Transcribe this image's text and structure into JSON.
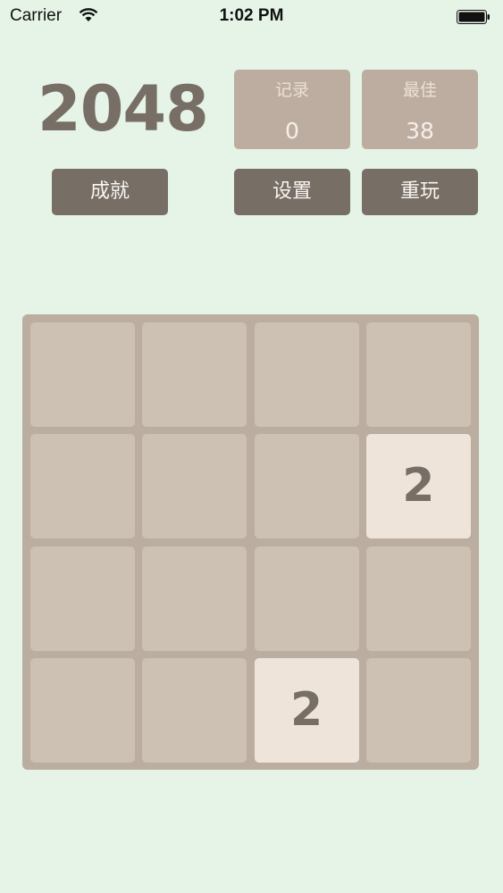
{
  "status_bar": {
    "carrier": "Carrier",
    "time": "1:02 PM"
  },
  "header": {
    "logo": "2048",
    "record": {
      "label": "记录",
      "value": "0"
    },
    "best": {
      "label": "最佳",
      "value": "38"
    }
  },
  "buttons": {
    "achievements": "成就",
    "settings": "设置",
    "restart": "重玩"
  },
  "board": {
    "size": 4,
    "tiles": [
      {
        "row": 1,
        "col": 3,
        "value": "2"
      },
      {
        "row": 3,
        "col": 2,
        "value": "2"
      }
    ]
  },
  "colors": {
    "background": "#e5f4e6",
    "board": "#bbada0",
    "empty_cell": "#cdc1b4",
    "tile_2": "#eee4da",
    "button": "#776e65",
    "score_box": "#bcada0",
    "text_dark": "#776e65"
  }
}
